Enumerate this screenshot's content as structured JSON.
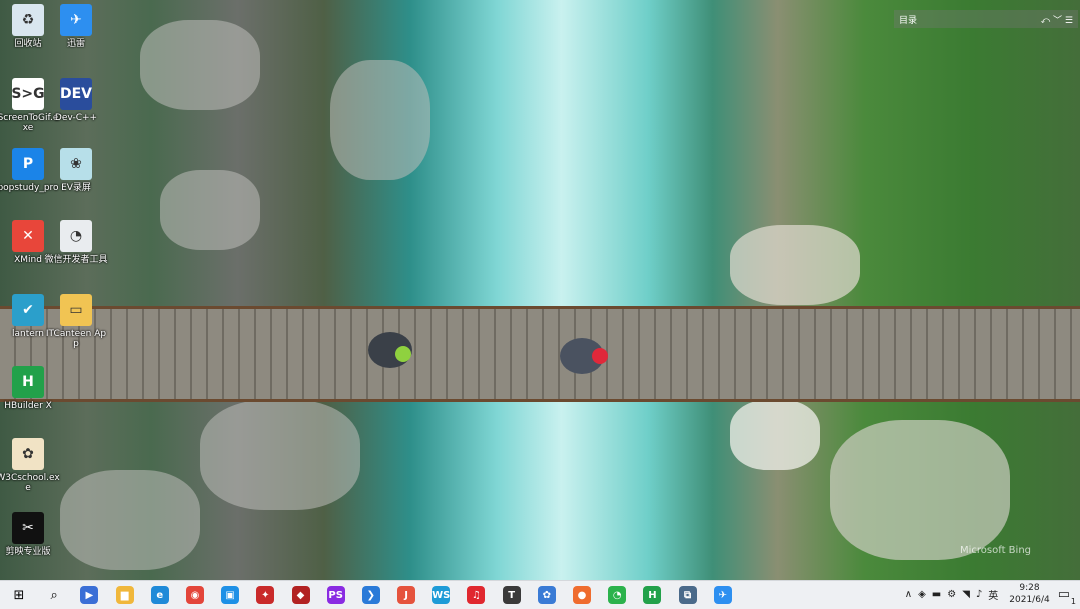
{
  "desktop_icons": [
    {
      "label": "回收站",
      "glyph": "♻",
      "color": "#d9e6ef"
    },
    {
      "label": "迅雷",
      "glyph": "✈",
      "color": "#2d8ff0"
    },
    {
      "label": "ScreenToGif.exe",
      "glyph": "S>G",
      "color": "#ffffff"
    },
    {
      "label": "Dev-C++",
      "glyph": "DEV",
      "color": "#2a4d9c"
    },
    {
      "label": "popstudy_pro",
      "glyph": "P",
      "color": "#1b84e8"
    },
    {
      "label": "EV录屏",
      "glyph": "❀",
      "color": "#b7dfe9"
    },
    {
      "label": "XMind",
      "glyph": "✕",
      "color": "#e8463a"
    },
    {
      "label": "微信开发者工具",
      "glyph": "◔",
      "color": "#e9ecef"
    },
    {
      "label": "lantern",
      "glyph": "✔",
      "color": "#2b9fcb"
    },
    {
      "label": "ITCanteen App",
      "glyph": "▭",
      "color": "#f1c453"
    },
    {
      "label": "HBuilder X",
      "glyph": "H",
      "color": "#22a14a"
    },
    {
      "label": "W3Cschool.exe",
      "glyph": "✿",
      "color": "#f1e3c5"
    },
    {
      "label": "剪映专业版",
      "glyph": "✂",
      "color": "#111111"
    }
  ],
  "widget": {
    "title": "目录",
    "icons": "⤺ ﹀ ☰"
  },
  "watermark": "Microsoft Bing",
  "taskbar": {
    "start_glyph": "⊞",
    "search_glyph": "⌕",
    "apps": [
      {
        "name": "remote-app",
        "glyph": "▶",
        "color": "#3b6fd6"
      },
      {
        "name": "file-explorer",
        "glyph": "▆",
        "color": "#f0b73b"
      },
      {
        "name": "edge",
        "glyph": "e",
        "color": "#1f8ad8"
      },
      {
        "name": "chrome",
        "glyph": "◉",
        "color": "#e3453a"
      },
      {
        "name": "app-store",
        "glyph": "▣",
        "color": "#1e90e6"
      },
      {
        "name": "red-app",
        "glyph": "✦",
        "color": "#c92a2a"
      },
      {
        "name": "red-app-2",
        "glyph": "◆",
        "color": "#b22222"
      },
      {
        "name": "phpstorm",
        "glyph": "PS",
        "color": "#8a2be2"
      },
      {
        "name": "vscode",
        "glyph": "❯",
        "color": "#2a7ad8"
      },
      {
        "name": "jetbrains",
        "glyph": "J",
        "color": "#e5533d"
      },
      {
        "name": "webstorm",
        "glyph": "WS",
        "color": "#1d9bd7"
      },
      {
        "name": "netease-music",
        "glyph": "♫",
        "color": "#e0282f"
      },
      {
        "name": "typora",
        "glyph": "T",
        "color": "#3a3a3a"
      },
      {
        "name": "blue-app",
        "glyph": "✿",
        "color": "#3a7bd5"
      },
      {
        "name": "postman",
        "glyph": "●",
        "color": "#ef6c2e"
      },
      {
        "name": "wechat-devtools",
        "glyph": "◔",
        "color": "#2bb24c"
      },
      {
        "name": "hbuilder",
        "glyph": "H",
        "color": "#22a14a"
      },
      {
        "name": "screen-app",
        "glyph": "⧉",
        "color": "#4a6a8a"
      },
      {
        "name": "thunder",
        "glyph": "✈",
        "color": "#2d8ff0"
      }
    ],
    "tray_icons": [
      "∧",
      "◈",
      "▬",
      "⚙",
      "◥",
      "♪",
      "英"
    ],
    "time": "9:28",
    "date": "2021/6/4",
    "notify_glyph": "▭",
    "notify_count": "1"
  }
}
